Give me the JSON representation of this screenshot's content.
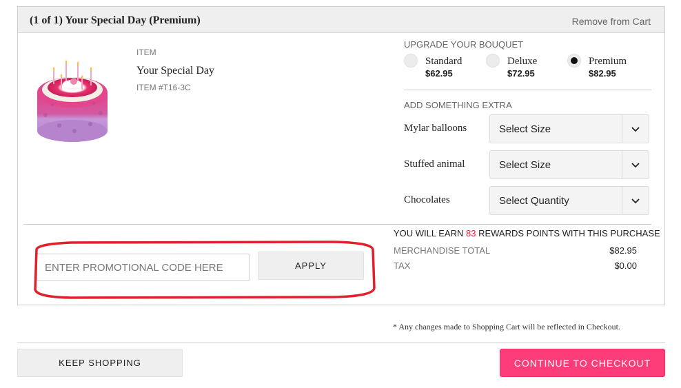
{
  "cart_item": {
    "title": "(1 of 1) Your Special Day (Premium)",
    "remove_label": "Remove from Cart",
    "item_label": "ITEM",
    "item_name": "Your Special Day",
    "item_number": "ITEM #T16-3C",
    "image_description": "flower-cake-arrangement"
  },
  "upgrade": {
    "heading": "UPGRADE YOUR BOUQUET",
    "options": [
      {
        "name": "Standard",
        "price": "$62.95",
        "selected": false
      },
      {
        "name": "Deluxe",
        "price": "$72.95",
        "selected": false
      },
      {
        "name": "Premium",
        "price": "$82.95",
        "selected": true
      }
    ]
  },
  "extras": {
    "heading": "ADD SOMETHING EXTRA",
    "items": [
      {
        "label": "Mylar balloons",
        "selected_value": "Select Size"
      },
      {
        "label": "Stuffed animal",
        "selected_value": "Select Size"
      },
      {
        "label": "Chocolates",
        "selected_value": "Select Quantity"
      }
    ]
  },
  "promo": {
    "placeholder": "ENTER PROMOTIONAL CODE HERE",
    "value": "",
    "apply_label": "APPLY",
    "highlight_color": "#e0202a"
  },
  "summary": {
    "rewards_prefix": "YOU WILL EARN ",
    "rewards_points": "83",
    "rewards_suffix": " REWARDS POINTS WITH THIS PURCHASE",
    "merchandise_label": "MERCHANDISE TOTAL",
    "merchandise_value": "$82.95",
    "tax_label": "TAX",
    "tax_value": "$0.00"
  },
  "footer": {
    "disclaimer": "* Any changes made to Shopping Cart will be reflected in Checkout.",
    "keep_shopping_label": "KEEP SHOPPING",
    "checkout_label": "CONTINUE TO CHECKOUT",
    "checkout_color": "#fd3c7a"
  }
}
